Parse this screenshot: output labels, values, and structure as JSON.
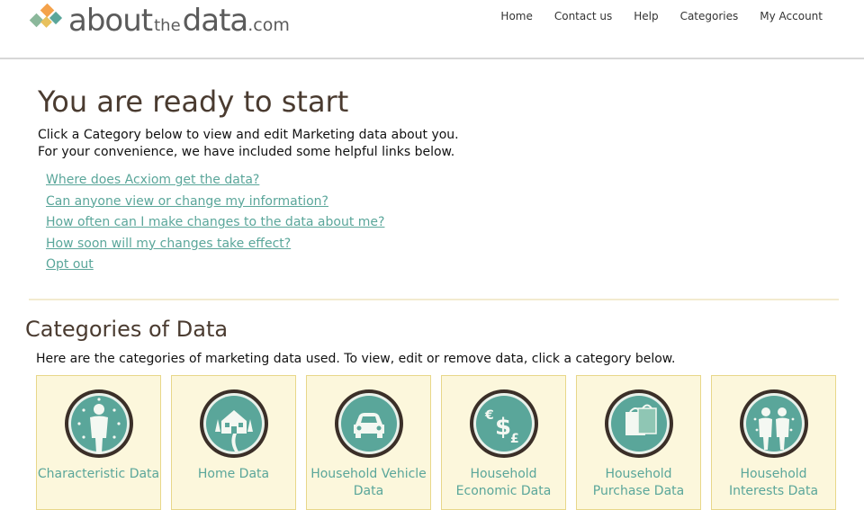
{
  "logo": {
    "about": "about",
    "the": "the",
    "data": "data",
    "com": ".com",
    "colors": [
      "#8bb89b",
      "#f4a24b",
      "#5aa69a",
      "#e8c15e"
    ]
  },
  "nav": {
    "items": [
      "Home",
      "Contact us",
      "Help",
      "Categories",
      "My Account"
    ]
  },
  "ready": {
    "title": "You are ready to start",
    "intro_line1": "Click a Category below to view and edit Marketing data about you.",
    "intro_line2": "For your convenience, we have included some helpful links below.",
    "links": [
      "Where does Acxiom get the data?",
      "Can anyone view or change my information?",
      "How often can I make changes to the data about me?",
      "How soon will my changes take effect?",
      "Opt out"
    ]
  },
  "categories": {
    "title": "Categories of Data",
    "intro": "Here are the categories of marketing data used. To view, edit or remove data, click a category below.",
    "tiles": [
      {
        "label": "Characteristic Data",
        "icon": "person-icon"
      },
      {
        "label": "Home Data",
        "icon": "house-icon"
      },
      {
        "label": "Household Vehicle Data",
        "icon": "car-icon"
      },
      {
        "label": "Household Economic Data",
        "icon": "currency-icon"
      },
      {
        "label": "Household Purchase Data",
        "icon": "shopping-bag-icon"
      },
      {
        "label": "Household Interests Data",
        "icon": "people-icon"
      }
    ]
  },
  "colors": {
    "link": "#5aa69a",
    "heading": "#4a3b30",
    "tile_bg": "#fcf7dc",
    "tile_border": "#e8d78a",
    "icon_fill": "#5aa69a",
    "icon_ring": "#3b2f28"
  }
}
